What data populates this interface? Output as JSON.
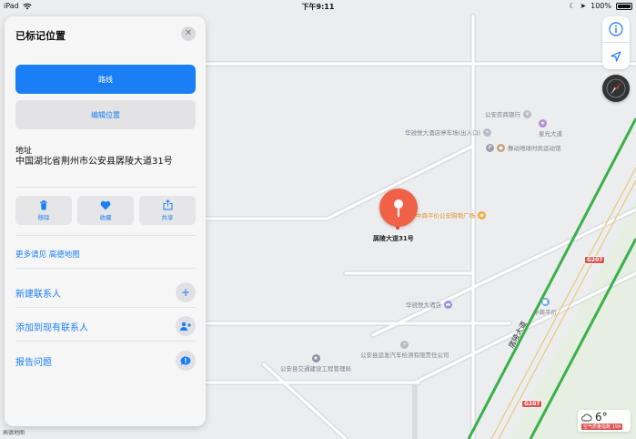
{
  "status_bar": {
    "device": "iPad",
    "time": "下午9:11",
    "battery": "100%"
  },
  "panel": {
    "title": "已标记位置",
    "route_label": "路线",
    "edit_label": "编辑位置",
    "address_label": "地址",
    "address_value": "中国湖北省荆州市公安县孱陵大道31号",
    "actions": [
      {
        "label": "移除",
        "icon": "trash-icon"
      },
      {
        "label": "收藏",
        "icon": "heart-icon"
      },
      {
        "label": "共享",
        "icon": "share-icon"
      }
    ],
    "more_link": "更多请见 高德地图",
    "rows": [
      {
        "label": "新建联系人",
        "icon": "plus-icon"
      },
      {
        "label": "添加到现有联系人",
        "icon": "add-contact-icon"
      },
      {
        "label": "报告问题",
        "icon": "report-bubble-icon"
      }
    ]
  },
  "map": {
    "pin_label": "孱陵大道31号",
    "pois": [
      {
        "name": "公安农商银行"
      },
      {
        "name": "星光大道"
      },
      {
        "name": "华锐悦大酒店停车场(出入口)"
      },
      {
        "name": "舞动地球时尚运动馆"
      },
      {
        "name": "中商平价公安购物广场"
      },
      {
        "name": "华锐悦大酒店"
      },
      {
        "name": "中商平价"
      },
      {
        "name": "公安县运发汽车检测有限责任公司"
      },
      {
        "name": "公安县交通建设工程管理局"
      }
    ],
    "road_label": "孱陵大道",
    "shields": [
      "G207",
      "G207"
    ],
    "attribution": "高德地图"
  },
  "weather": {
    "temperature": "6°",
    "aqi": "空气质量指数 199"
  },
  "colors": {
    "accent": "#1a7ff5",
    "pin": "#f06147",
    "road_green": "#3ab04a"
  }
}
